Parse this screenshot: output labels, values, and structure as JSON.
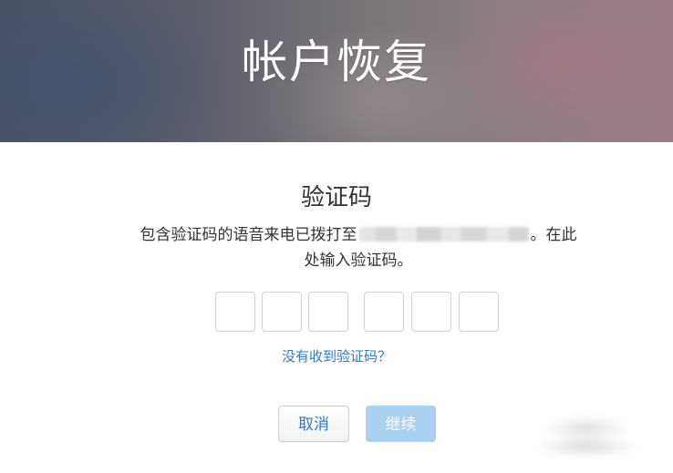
{
  "header": {
    "title": "帐户恢复"
  },
  "verification": {
    "title": "验证码",
    "description_prefix": "包含验证码的语音来电已拨打至",
    "description_suffix": "。在此",
    "description_line2": "处输入验证码。",
    "code_digit_count": 6,
    "resend_link": "没有收到验证码？"
  },
  "actions": {
    "cancel_label": "取消",
    "continue_label": "继续"
  },
  "colors": {
    "link": "#2f7bc8",
    "continue_disabled_bg": "#a8d0f0"
  }
}
